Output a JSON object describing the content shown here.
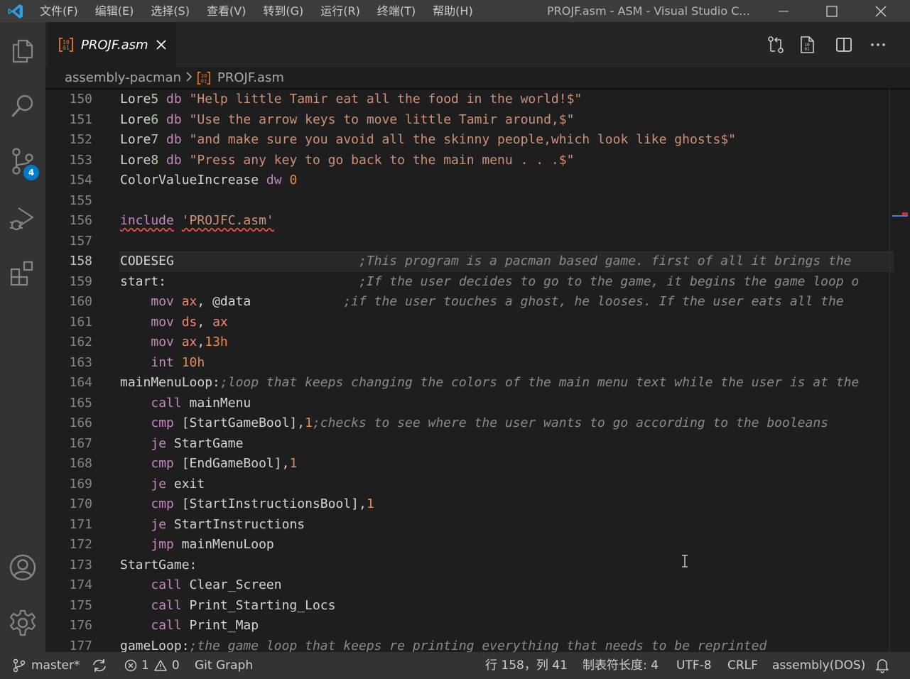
{
  "titlebar": {
    "menu": [
      "文件(F)",
      "编辑(E)",
      "选择(S)",
      "查看(V)",
      "转到(G)",
      "运行(R)",
      "终端(T)",
      "帮助(H)"
    ],
    "window_title": "PROJF.asm - ASM - Visual Studio C..."
  },
  "activitybar": {
    "scm_badge": "4"
  },
  "tabs": [
    {
      "label": "PROJF.asm",
      "icon": "asm-file-icon",
      "active": true
    }
  ],
  "breadcrumb": {
    "folder": "assembly-pacman",
    "file": "PROJF.asm"
  },
  "editor": {
    "current_line": "158",
    "lines": [
      {
        "n": "150",
        "tokens": [
          [
            "label",
            "Lore"
          ],
          [
            "num",
            "5"
          ],
          [
            "label",
            " "
          ],
          [
            "kw",
            "db"
          ],
          [
            "label",
            " "
          ],
          [
            "str",
            "\"Help little Tamir eat all the food in the world!$\""
          ]
        ]
      },
      {
        "n": "151",
        "tokens": [
          [
            "label",
            "Lore"
          ],
          [
            "num",
            "6"
          ],
          [
            "label",
            " "
          ],
          [
            "kw",
            "db"
          ],
          [
            "label",
            " "
          ],
          [
            "str",
            "\"Use the arrow keys to move little Tamir around,$\""
          ]
        ]
      },
      {
        "n": "152",
        "tokens": [
          [
            "label",
            "Lore"
          ],
          [
            "num",
            "7"
          ],
          [
            "label",
            " "
          ],
          [
            "kw",
            "db"
          ],
          [
            "label",
            " "
          ],
          [
            "str",
            "\"and make sure you avoid all the skinny people,which look like ghosts$\""
          ]
        ]
      },
      {
        "n": "153",
        "tokens": [
          [
            "label",
            "Lore"
          ],
          [
            "num",
            "8"
          ],
          [
            "label",
            " "
          ],
          [
            "kw",
            "db"
          ],
          [
            "label",
            " "
          ],
          [
            "str",
            "\"Press any key to go back to the main menu . . .$\""
          ]
        ]
      },
      {
        "n": "154",
        "tokens": [
          [
            "label",
            "ColorValueIncrease "
          ],
          [
            "kw",
            "dw"
          ],
          [
            "label",
            " "
          ],
          [
            "numo",
            "0"
          ]
        ]
      },
      {
        "n": "155",
        "tokens": []
      },
      {
        "n": "156",
        "tokens": [
          [
            "inc",
            "include"
          ],
          [
            "label",
            " "
          ],
          [
            "incstr",
            "'PROJFC.asm'"
          ]
        ]
      },
      {
        "n": "157",
        "tokens": []
      },
      {
        "n": "158",
        "tokens": [
          [
            "label",
            "CODESEG                        "
          ],
          [
            "cmt",
            ";This program is a pacman based game. first of all it brings the"
          ]
        ]
      },
      {
        "n": "159",
        "tokens": [
          [
            "label",
            "start:                         "
          ],
          [
            "cmt",
            ";If the user decides to go to the game, it begins the game loop o"
          ]
        ]
      },
      {
        "n": "160",
        "tokens": [
          [
            "label",
            "    "
          ],
          [
            "kw",
            "mov"
          ],
          [
            "label",
            " "
          ],
          [
            "reg",
            "ax"
          ],
          [
            "label",
            ", @data            "
          ],
          [
            "cmt",
            ";if the user touches a ghost, he looses. If the user eats all the"
          ]
        ]
      },
      {
        "n": "161",
        "tokens": [
          [
            "label",
            "    "
          ],
          [
            "kw",
            "mov"
          ],
          [
            "label",
            " "
          ],
          [
            "reg",
            "ds"
          ],
          [
            "label",
            ", "
          ],
          [
            "reg",
            "ax"
          ]
        ]
      },
      {
        "n": "162",
        "tokens": [
          [
            "label",
            "    "
          ],
          [
            "kw",
            "mov"
          ],
          [
            "label",
            " "
          ],
          [
            "reg",
            "ax"
          ],
          [
            "label",
            ","
          ],
          [
            "numo",
            "13h"
          ]
        ]
      },
      {
        "n": "163",
        "tokens": [
          [
            "label",
            "    "
          ],
          [
            "kw",
            "int"
          ],
          [
            "label",
            " "
          ],
          [
            "numo",
            "10h"
          ]
        ]
      },
      {
        "n": "164",
        "tokens": [
          [
            "label",
            "mainMenuLoop:"
          ],
          [
            "cmt",
            ";loop that keeps changing the colors of the main menu text while the user is at the"
          ]
        ]
      },
      {
        "n": "165",
        "tokens": [
          [
            "label",
            "    "
          ],
          [
            "kw",
            "call"
          ],
          [
            "label",
            " mainMenu"
          ]
        ]
      },
      {
        "n": "166",
        "tokens": [
          [
            "label",
            "    "
          ],
          [
            "kw",
            "cmp"
          ],
          [
            "label",
            " [StartGameBool],"
          ],
          [
            "numo",
            "1"
          ],
          [
            "cmt",
            ";checks to see where the user wants to go according to the booleans"
          ]
        ]
      },
      {
        "n": "167",
        "tokens": [
          [
            "label",
            "    "
          ],
          [
            "kw",
            "je"
          ],
          [
            "label",
            " StartGame"
          ]
        ]
      },
      {
        "n": "168",
        "tokens": [
          [
            "label",
            "    "
          ],
          [
            "kw",
            "cmp"
          ],
          [
            "label",
            " [EndGameBool],"
          ],
          [
            "numo",
            "1"
          ]
        ]
      },
      {
        "n": "169",
        "tokens": [
          [
            "label",
            "    "
          ],
          [
            "kw",
            "je"
          ],
          [
            "label",
            " exit"
          ]
        ]
      },
      {
        "n": "170",
        "tokens": [
          [
            "label",
            "    "
          ],
          [
            "kw",
            "cmp"
          ],
          [
            "label",
            " [StartInstructionsBool],"
          ],
          [
            "numo",
            "1"
          ]
        ]
      },
      {
        "n": "171",
        "tokens": [
          [
            "label",
            "    "
          ],
          [
            "kw",
            "je"
          ],
          [
            "label",
            " StartInstructions"
          ]
        ]
      },
      {
        "n": "172",
        "tokens": [
          [
            "label",
            "    "
          ],
          [
            "kw",
            "jmp"
          ],
          [
            "label",
            " mainMenuLoop"
          ]
        ]
      },
      {
        "n": "173",
        "tokens": [
          [
            "label",
            "StartGame:"
          ]
        ]
      },
      {
        "n": "174",
        "tokens": [
          [
            "label",
            "    "
          ],
          [
            "kw",
            "call"
          ],
          [
            "label",
            " Clear_Screen"
          ]
        ]
      },
      {
        "n": "175",
        "tokens": [
          [
            "label",
            "    "
          ],
          [
            "kw",
            "call"
          ],
          [
            "label",
            " Print_Starting_Locs"
          ]
        ]
      },
      {
        "n": "176",
        "tokens": [
          [
            "label",
            "    "
          ],
          [
            "kw",
            "call"
          ],
          [
            "label",
            " Print_Map"
          ]
        ]
      },
      {
        "n": "177",
        "tokens": [
          [
            "label",
            "gameLoop:"
          ],
          [
            "cmt",
            ";the game loop that keeps re printing everything that needs to be reprinted"
          ]
        ]
      }
    ]
  },
  "statusbar": {
    "branch": "master*",
    "errors": "1",
    "warnings": "0",
    "git_graph": "Git Graph",
    "position": "行 158，列 41",
    "tab_size": "制表符长度: 4",
    "encoding": "UTF-8",
    "eol": "CRLF",
    "language": "assembly(DOS)"
  },
  "colors": {
    "accent": "#007acc",
    "keyword": "#c586c0",
    "string": "#ce9178",
    "register": "#f48771",
    "number": "#e78a4e",
    "comment": "#8a8a8a"
  }
}
